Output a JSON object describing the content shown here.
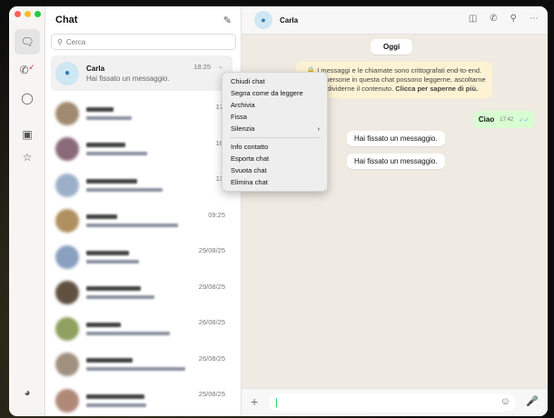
{
  "sidebar": {
    "icons": [
      "chats-icon",
      "calls-icon",
      "status-icon",
      "archive-icon",
      "starred-icon",
      "settings-icon"
    ]
  },
  "list": {
    "title": "Chat",
    "search_placeholder": "Cerca",
    "chats": [
      {
        "name": "Carla",
        "preview": "Hai fissato un messaggio.",
        "time": "18:25"
      },
      {
        "time": "17:"
      },
      {
        "time": "16:"
      },
      {
        "time": "13:"
      },
      {
        "time": "09:25"
      },
      {
        "time": "29/08/25"
      },
      {
        "time": "29/08/25"
      },
      {
        "time": "26/08/25"
      },
      {
        "time": "26/08/25"
      },
      {
        "time": "25/08/25"
      }
    ]
  },
  "chat": {
    "contact": "Carla",
    "date_label": "Oggi",
    "encryption": {
      "text": "I messaggi e le chiamate sono crittografati end-to-end. Solo le persone in questa chat possono leggerne, ascoltarne o condividerne il contenuto.",
      "link": "Clicca per saperne di più."
    },
    "outgoing": {
      "text": "Ciao",
      "time": "17:42"
    },
    "system": [
      "Hai fissato un messaggio.",
      "Hai fissato un messaggio."
    ]
  },
  "menu": {
    "group1": [
      "Chiudi chat",
      "Segna come da leggere",
      "Archivia",
      "Fissa",
      "Silenzia"
    ],
    "group2": [
      "Info contatto",
      "Esporta chat",
      "Svuota chat",
      "Elimina chat"
    ]
  },
  "colors": {
    "accent": "#25d366",
    "outgoing_bubble": "#d9fdd3",
    "encryption_bg": "#fdf3d4"
  }
}
